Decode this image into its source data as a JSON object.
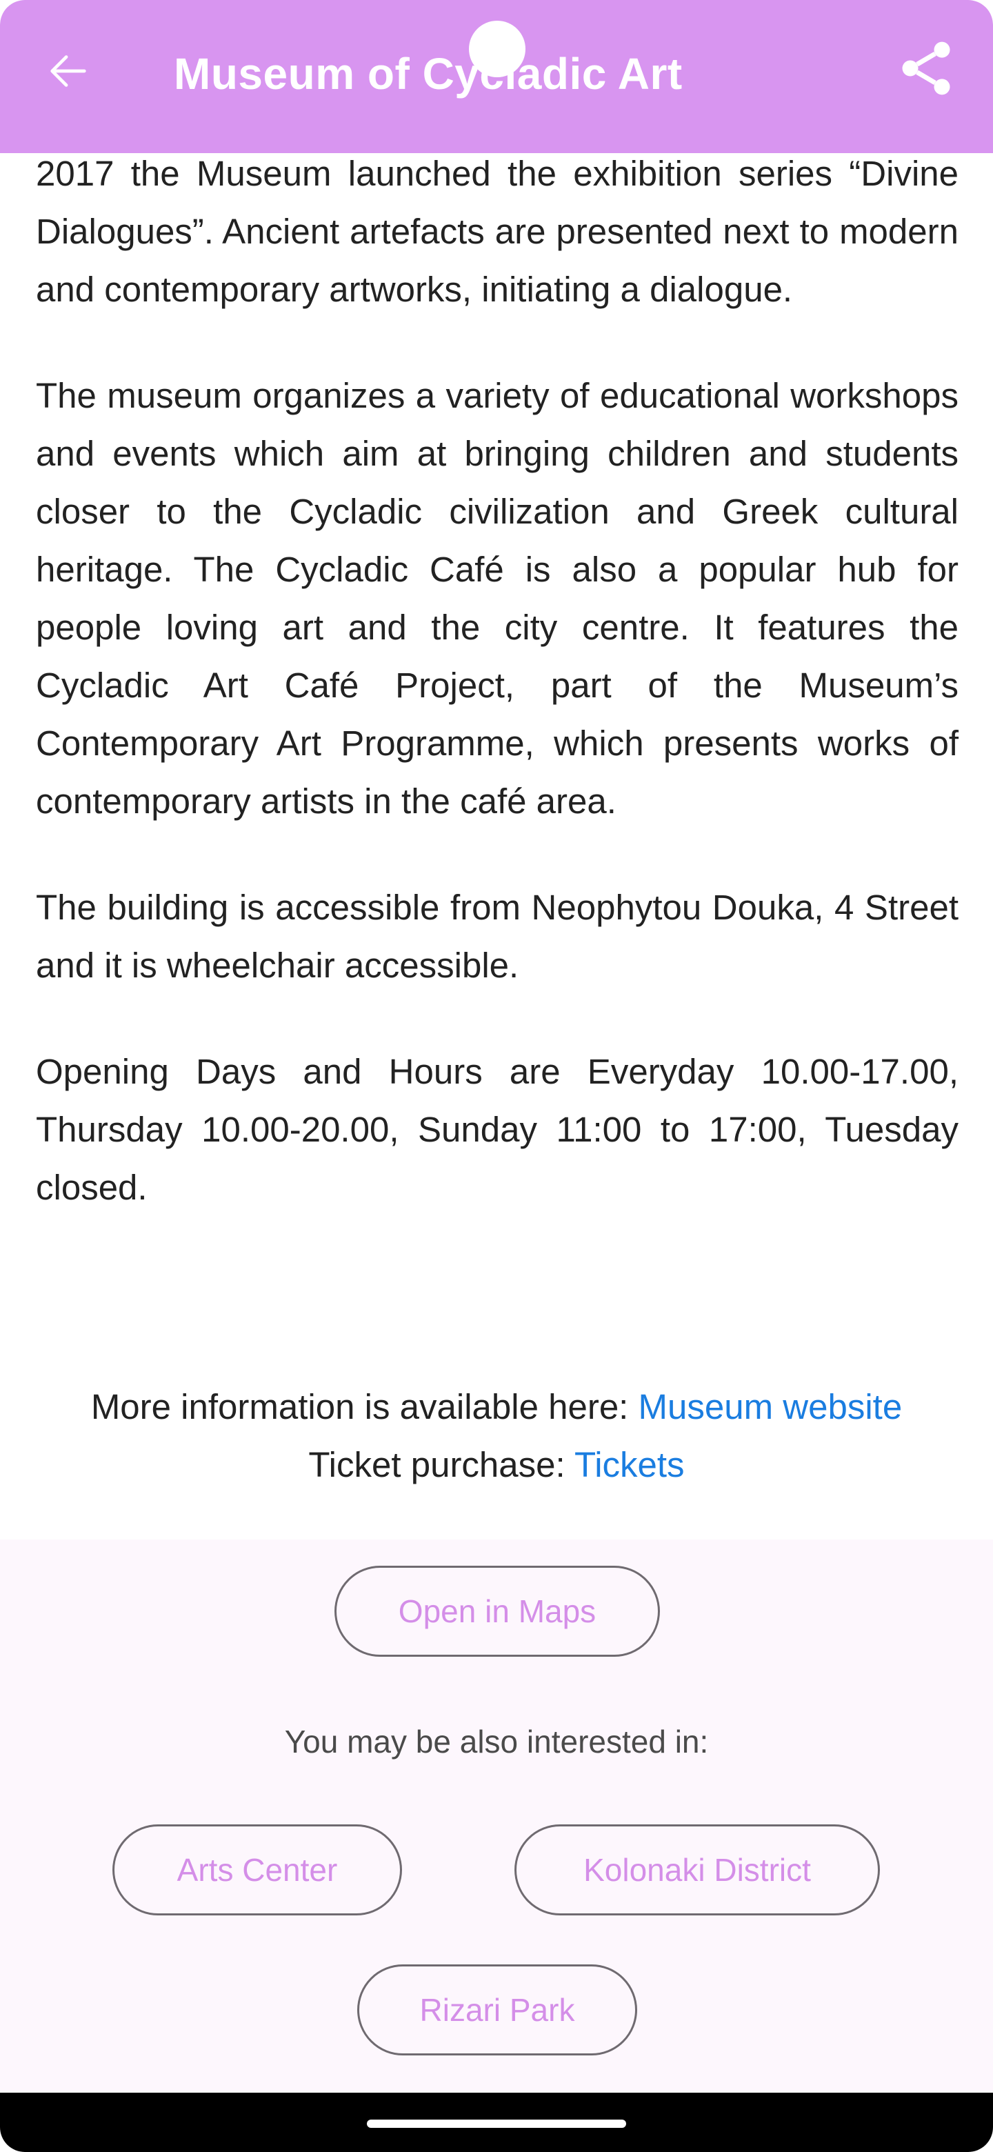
{
  "header": {
    "title": "Museum of Cycladic Art",
    "background": "#d895f0",
    "back_icon": "arrow-left-icon",
    "share_icon": "share-icon"
  },
  "body": {
    "paragraphs": [
      "2017 the Museum launched the exhibition series “Divine Dialogues”. Ancient artefacts are presented next to modern and contemporary artworks, initiating a dialogue.",
      "The museum organizes a variety of educational workshops and events which aim at bringing children and students closer to the Cycladic civilization and Greek cultural heritage. The Cycladic Café is also a popular hub for people loving art and the city centre. It features the Cycladic Art Café Project, part of the Museum’s Contemporary Art Programme, which presents works of contemporary artists in the café area.",
      "The building is accessible from Neophytou Douka, 4 Street and it is wheelchair accessible.",
      "Opening Days and Hours are Everyday 10.00-17.00, Thursday 10.00-20.00, Sunday 11:00 to 17:00, Tuesday closed."
    ],
    "more_info_label": "More information is available here: ",
    "more_info_link": "Museum website",
    "ticket_label": "Ticket purchase: ",
    "ticket_link": "Tickets",
    "link_color": "#1a7de0"
  },
  "actions": {
    "open_maps": "Open in Maps",
    "also_interested": "You may be also interested in:",
    "related": [
      "Arts Center",
      "Kolonaki District",
      "Rizari Park"
    ],
    "accent": "#d48ee8"
  }
}
